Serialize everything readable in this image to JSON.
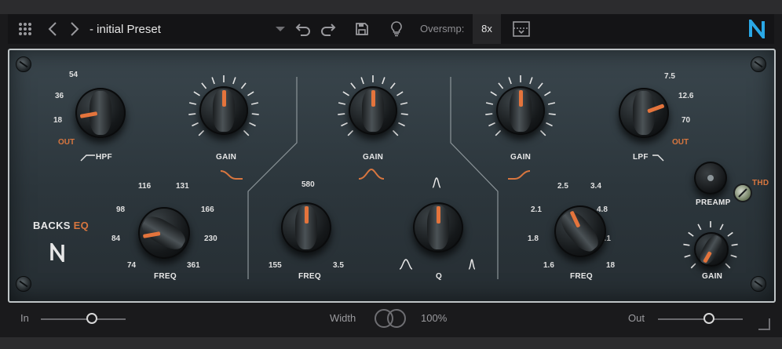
{
  "toolbar": {
    "preset_name": "- initial Preset",
    "oversampling_label": "Oversmp:",
    "oversampling_value": "8x",
    "icons": [
      "grid-menu-icon",
      "back-arrow-icon",
      "forward-arrow-icon",
      "dropdown-icon",
      "undo-icon",
      "redo-icon",
      "save-icon",
      "lightbulb-icon",
      "layout-icon",
      "n-logo-icon"
    ]
  },
  "brand": {
    "name_part1": "BACKS",
    "name_part2": "EQ",
    "accent": "#d8763f"
  },
  "hpf": {
    "ticks": [
      "54",
      "36",
      "18",
      "OUT"
    ],
    "label": "HPF"
  },
  "lpf": {
    "ticks": [
      "7.5",
      "12.6",
      "70",
      "OUT"
    ],
    "label": "LPF"
  },
  "low_band": {
    "gain_label": "GAIN",
    "freq_label": "FREQ",
    "freq_ticks": [
      "116",
      "131",
      "98",
      "166",
      "84",
      "230",
      "74",
      "361"
    ]
  },
  "mid_band": {
    "gain_label": "GAIN",
    "freq_label": "FREQ",
    "freq_ticks": [
      "580",
      "155",
      "3.5"
    ],
    "q_label": "Q"
  },
  "high_band": {
    "gain_label": "GAIN",
    "freq_label": "FREQ",
    "freq_ticks": [
      "2.5",
      "3.4",
      "2.1",
      "4.8",
      "1.8",
      "7.1",
      "1.6",
      "18"
    ]
  },
  "preamp": {
    "label": "PREAMP",
    "thd_label": "THD"
  },
  "output_gain": {
    "label": "GAIN"
  },
  "bottom": {
    "in_label": "In",
    "in_value": 0.6,
    "width_label": "Width",
    "width_value": "100%",
    "out_label": "Out",
    "out_value": 0.6
  }
}
